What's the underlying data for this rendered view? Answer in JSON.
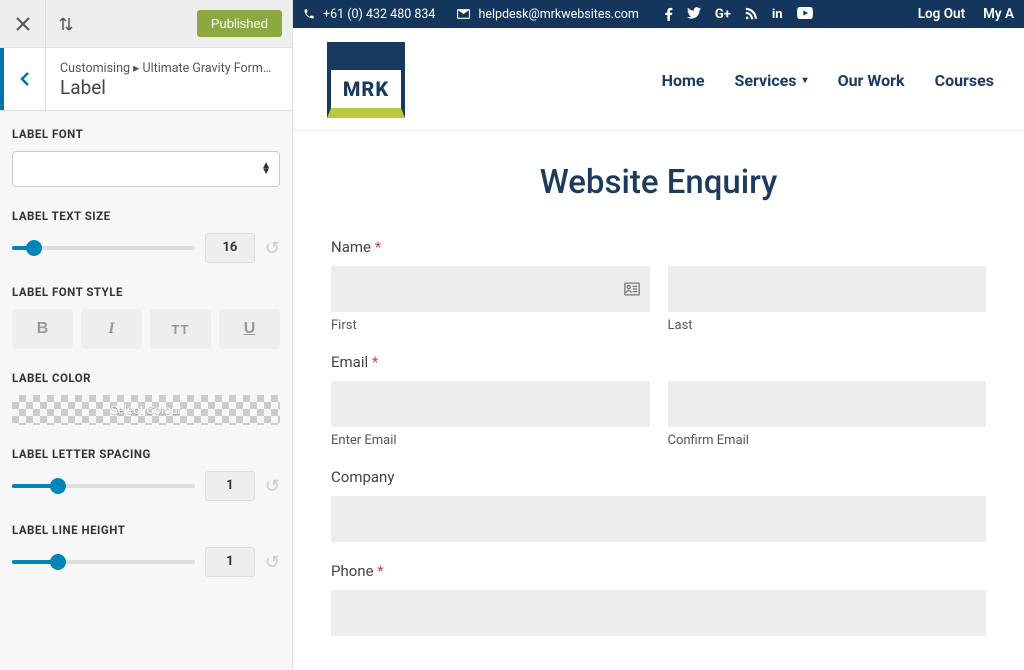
{
  "panel": {
    "published_label": "Published",
    "breadcrumb": "Customising ▸ Ultimate Gravity Form…",
    "section_title": "Label",
    "controls": {
      "font_label": "LABEL FONT",
      "text_size_label": "LABEL TEXT SIZE",
      "text_size_value": "16",
      "font_style_label": "LABEL FONT STYLE",
      "color_label": "LABEL COLOR",
      "color_button": "Select Colour",
      "letter_spacing_label": "LABEL LETTER SPACING",
      "letter_spacing_value": "1",
      "line_height_label": "LABEL LINE HEIGHT",
      "line_height_value": "1"
    }
  },
  "topbar": {
    "phone": "+61 (0) 432 480 834",
    "email": "helpdesk@mrkwebsites.com",
    "logout": "Log Out",
    "my_account": "My A"
  },
  "logo_text": "MRK",
  "nav": {
    "home": "Home",
    "services": "Services",
    "work": "Our Work",
    "courses": "Courses"
  },
  "page": {
    "heading": "Website Enquiry",
    "name_label": "Name",
    "first_sub": "First",
    "last_sub": "Last",
    "email_label": "Email",
    "enter_email_sub": "Enter Email",
    "confirm_email_sub": "Confirm Email",
    "company_label": "Company",
    "phone_label": "Phone",
    "required_mark": "*"
  }
}
